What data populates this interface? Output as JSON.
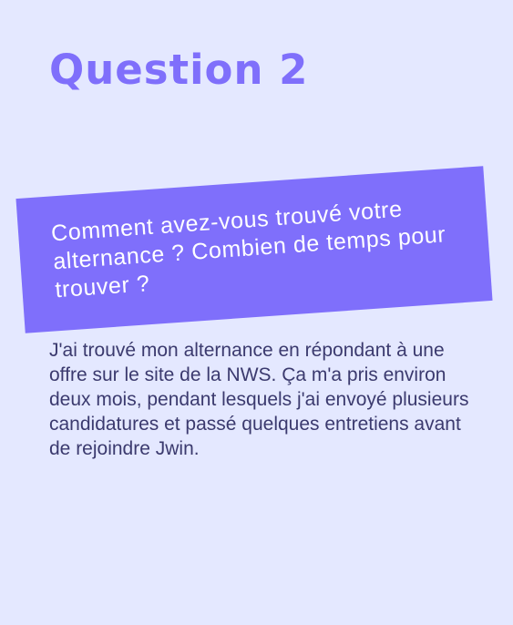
{
  "slide": {
    "title": "Question 2",
    "question": "Comment avez-vous trouvé votre alternance ? Combien de temps pour trouver ?",
    "answer": "J'ai trouvé mon alternance en répondant à une offre sur le site de la NWS. Ça m'a pris environ deux mois, pendant lesquels j'ai envoyé plusieurs candidatures et passé quelques entretiens avant de rejoindre Jwin."
  },
  "colors": {
    "background": "#e4e8ff",
    "accent": "#7f6ffb",
    "question_text": "#ffffff",
    "answer_text": "#3b3a6e"
  }
}
